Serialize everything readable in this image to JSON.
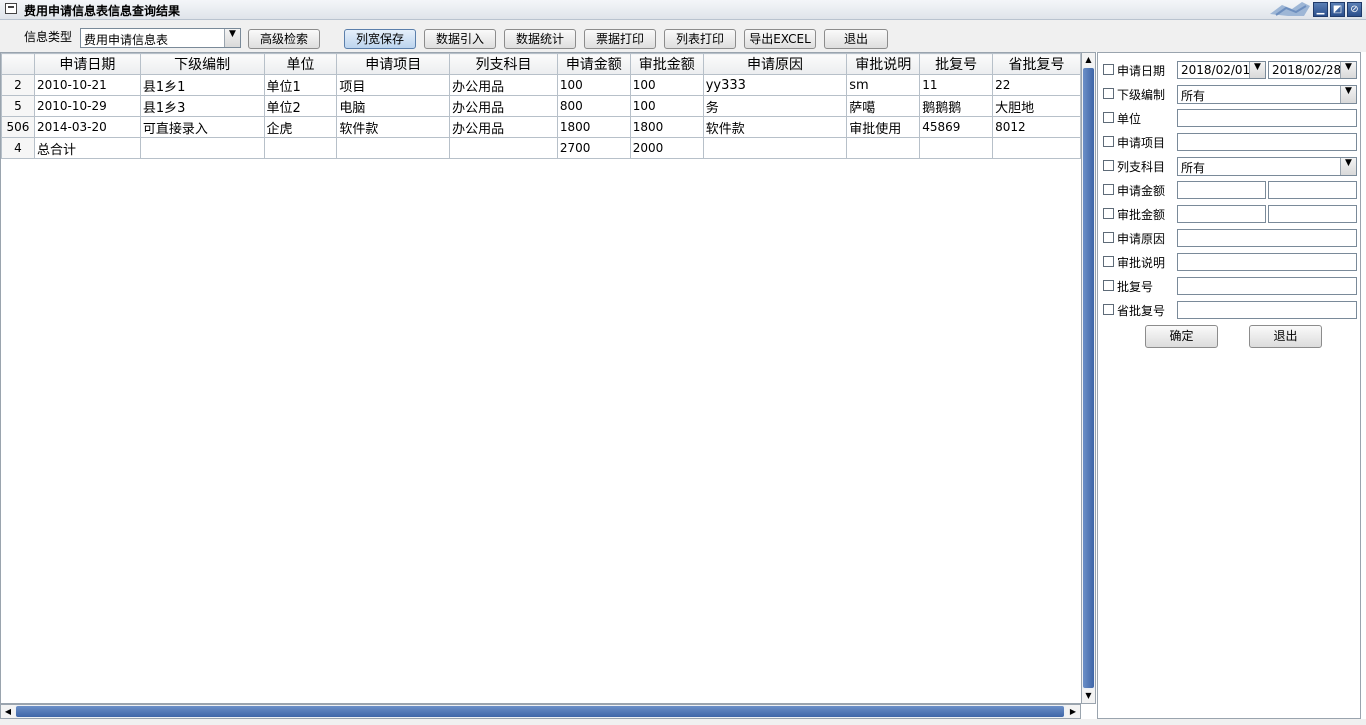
{
  "window": {
    "title": "费用申请信息表信息查询结果",
    "icons": [
      "window-app-icon",
      "minimize-icon",
      "restore-icon",
      "close-icon"
    ]
  },
  "toolbar": {
    "info_type_label": "信息类型",
    "info_type_value": "费用申请信息表",
    "buttons": {
      "advanced_search": "高级检索",
      "save_widths": "列宽保存",
      "import": "数据引入",
      "stats": "数据统计",
      "ticket_print": "票据打印",
      "list_print": "列表打印",
      "export_excel": "导出EXCEL",
      "exit": "退出"
    }
  },
  "grid": {
    "columns": [
      "申请日期",
      "下级编制",
      "单位",
      "申请项目",
      "列支科目",
      "申请金额",
      "审批金额",
      "申请原因",
      "审批说明",
      "批复号",
      "省批复号"
    ],
    "rows": [
      {
        "num": "2",
        "cells": [
          "2010-10-21",
          "县1乡1",
          "单位1",
          "项目",
          "办公用品",
          "100",
          "100",
          "yy333",
          "sm",
          "11",
          "22"
        ]
      },
      {
        "num": "5",
        "cells": [
          "2010-10-29",
          "县1乡3",
          "单位2",
          "电脑",
          "办公用品",
          "800",
          "100",
          "务",
          "萨噶",
          "鹅鹅鹅",
          "大胆地"
        ]
      },
      {
        "num": "506",
        "cells": [
          "2014-03-20",
          "可直接录入",
          "企虎",
          "软件款",
          "办公用品",
          "1800",
          "1800",
          "软件款",
          "审批使用",
          "45869",
          "8012"
        ]
      },
      {
        "num": "4",
        "cells": [
          "总合计",
          "",
          "",
          "",
          "",
          "2700",
          "2000",
          "",
          "",
          "",
          ""
        ]
      }
    ]
  },
  "filter": {
    "apply_date": {
      "label": "申请日期",
      "from": "2018/02/01",
      "to": "2018/02/28"
    },
    "sub_org": {
      "label": "下级编制",
      "value": "所有"
    },
    "unit": {
      "label": "单位"
    },
    "apply_item": {
      "label": "申请项目"
    },
    "subject": {
      "label": "列支科目",
      "value": "所有"
    },
    "apply_amount": {
      "label": "申请金额"
    },
    "approve_amount": {
      "label": "审批金额"
    },
    "reason": {
      "label": "申请原因"
    },
    "approve_note": {
      "label": "审批说明"
    },
    "reply_no": {
      "label": "批复号"
    },
    "prov_reply_no": {
      "label": "省批复号"
    },
    "ok_label": "确定",
    "exit_label": "退出"
  }
}
